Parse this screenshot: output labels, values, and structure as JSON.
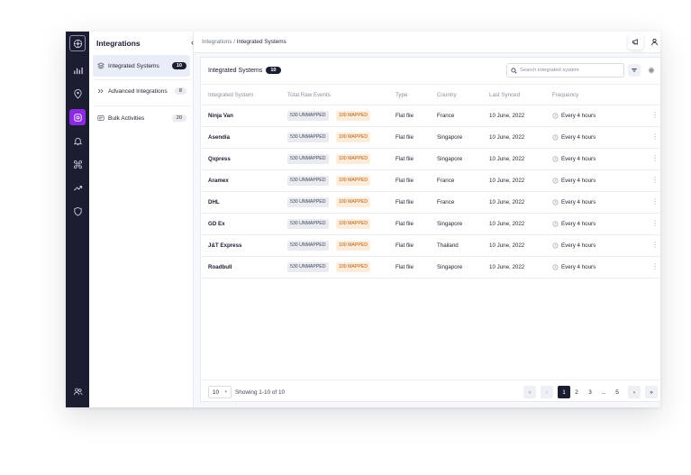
{
  "sidebar": {
    "title": "Integrations",
    "collapse_icon": "chevron-left-icon",
    "items": [
      {
        "label": "Integrated Systems",
        "count": "10",
        "icon": "layers-icon"
      },
      {
        "label": "Advanced Integrations",
        "count": "8",
        "icon": "double-chevron-icon"
      },
      {
        "label": "Bulk Activities",
        "count": "20",
        "icon": "list-icon"
      }
    ]
  },
  "rail": {
    "icons": [
      "app-logo-icon",
      "chart-icon",
      "location-pin-icon",
      "integrations-icon",
      "bell-icon",
      "command-icon",
      "trending-icon",
      "shield-icon",
      "users-icon"
    ],
    "active": "integrations-icon",
    "active_color": "#8a2be2"
  },
  "breadcrumb": {
    "root": "Integrations",
    "separator": "/",
    "current": "Integrated Systems"
  },
  "topbar": {
    "icons": [
      "megaphone-icon",
      "user-icon"
    ]
  },
  "panel": {
    "title": "Integrated Systems",
    "count": "10",
    "search_placeholder": "Search integrated system"
  },
  "table": {
    "columns": [
      "Integrated System",
      "Total Raw Events",
      "Type",
      "Country",
      "Last Synced",
      "Frequency"
    ],
    "rows": [
      {
        "name": "Ninja Van",
        "unmapped": "530 UNMAPPED",
        "mapped": "100 MAPPED",
        "type": "Flat file",
        "country": "France",
        "synced": "10 June, 2022",
        "freq": "Every 4 hours"
      },
      {
        "name": "Asendia",
        "unmapped": "530 UNMAPPED",
        "mapped": "100 MAPPED",
        "type": "Flat file",
        "country": "Singapore",
        "synced": "10 June, 2022",
        "freq": "Every 4 hours"
      },
      {
        "name": "Qxpress",
        "unmapped": "530 UNMAPPED",
        "mapped": "100 MAPPED",
        "type": "Flat file",
        "country": "Singapore",
        "synced": "10 June, 2022",
        "freq": "Every 4 hours"
      },
      {
        "name": "Aramex",
        "unmapped": "530 UNMAPPED",
        "mapped": "100 MAPPED",
        "type": "Flat file",
        "country": "France",
        "synced": "10 June, 2022",
        "freq": "Every 4 hours"
      },
      {
        "name": "DHL",
        "unmapped": "530 UNMAPPED",
        "mapped": "100 MAPPED",
        "type": "Flat file",
        "country": "France",
        "synced": "10 June, 2022",
        "freq": "Every 4 hours"
      },
      {
        "name": "GD Ex",
        "unmapped": "530 UNMAPPED",
        "mapped": "100 MAPPED",
        "type": "Flat file",
        "country": "Singapore",
        "synced": "10 June, 2022",
        "freq": "Every 4 hours"
      },
      {
        "name": "J&T Express",
        "unmapped": "530 UNMAPPED",
        "mapped": "100 MAPPED",
        "type": "Flat file",
        "country": "Thailand",
        "synced": "10 June, 2022",
        "freq": "Every 4 hours"
      },
      {
        "name": "Roadbull",
        "unmapped": "530 UNMAPPED",
        "mapped": "100 MAPPED",
        "type": "Flat file",
        "country": "Singapore",
        "synced": "10 June, 2022",
        "freq": "Every 4 hours"
      }
    ]
  },
  "footer": {
    "page_size": "10",
    "showing": "Showing 1-10 of 10",
    "pages": [
      "1",
      "2",
      "3",
      "...",
      "5"
    ],
    "current_page": "1",
    "first": "«",
    "prev": "‹",
    "next": "›",
    "last": "»"
  },
  "colors": {
    "dark": "#1b1d31",
    "accent": "#8a2be2",
    "mapped_bg": "#fdecd9",
    "mapped_text": "#b25b10"
  }
}
